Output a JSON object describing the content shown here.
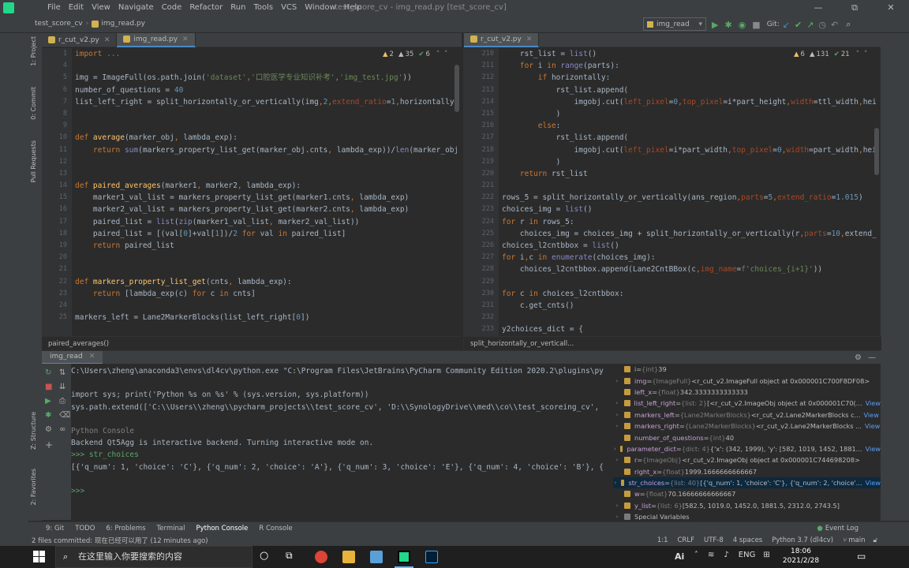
{
  "window": {
    "title": "test_score_cv - img_read.py [test_score_cv]",
    "menu": [
      "File",
      "Edit",
      "View",
      "Navigate",
      "Code",
      "Refactor",
      "Run",
      "Tools",
      "VCS",
      "Window",
      "Help"
    ],
    "controls": {
      "minimize": "—",
      "maximize": "⧉",
      "close": "✕"
    }
  },
  "navbar": {
    "project": "test_score_cv",
    "file": "img_read.py",
    "run_config": "img_read",
    "git_label": "Git:"
  },
  "left_tools": [
    "1: Project",
    "0: Commit",
    "Pull Requests",
    "Z: Structure",
    "2: Favorites"
  ],
  "left_editor": {
    "tabs": [
      {
        "label": "r_cut_v2.py",
        "active": false
      },
      {
        "label": "img_read.py",
        "active": true
      }
    ],
    "inspections": {
      "warnings": "2",
      "weak": "35",
      "ok": "6"
    },
    "breadcrumb": "paired_averages()",
    "line_numbers": [
      "1",
      "4",
      "5",
      "6",
      "7",
      "8",
      "9",
      "10",
      "11",
      "12",
      "13",
      "14",
      "15",
      "16",
      "17",
      "18",
      "19",
      "20",
      "21",
      "22",
      "23",
      "24",
      "25"
    ],
    "lines": [
      "import ...",
      "",
      "img = ImageFull(os.path.join('dataset','口腔医学专业知识补考','img_test.jpg'))",
      "number_of_questions = 40",
      "list_left_right = split_horizontally_or_vertically(img,2,extend_ratio=1,horizontally=",
      "",
      "",
      "def average(marker_obj, lambda_exp):",
      "    return sum(markers_property_list_get(marker_obj.cnts, lambda_exp))/len(marker_obj",
      "",
      "",
      "def paired_averages(marker1, marker2, lambda_exp):",
      "    marker1_val_list = markers_property_list_get(marker1.cnts, lambda_exp)",
      "    marker2_val_list = markers_property_list_get(marker2.cnts, lambda_exp)",
      "    paired_list = list(zip(marker1_val_list, marker2_val_list))",
      "    paired_list = [(val[0]+val[1])/2 for val in paired_list]",
      "    return paired_list",
      "",
      "",
      "def markers_property_list_get(cnts, lambda_exp):",
      "    return [lambda_exp(c) for c in cnts]",
      "",
      "markers_left = Lane2MarkerBlocks(list_left_right[0])"
    ]
  },
  "right_editor": {
    "tabs": [
      {
        "label": "r_cut_v2.py",
        "active": true
      }
    ],
    "inspections": {
      "warnings": "6",
      "weak": "131",
      "ok": "21"
    },
    "breadcrumb": "split_horizontally_or_verticall...",
    "line_numbers": [
      "210",
      "211",
      "212",
      "213",
      "214",
      "215",
      "216",
      "217",
      "218",
      "219",
      "220",
      "221",
      "222",
      "223",
      "224",
      "225",
      "226",
      "227",
      "228",
      "229",
      "230",
      "231",
      "232",
      "233"
    ],
    "lines": [
      "    rst_list = list()",
      "    for i in range(parts):",
      "        if horizontally:",
      "            rst_list.append(",
      "                imgobj.cut(left_pixel=0,top_pixel=i*part_height,width=ttl_width,hei",
      "            )",
      "        else:",
      "            rst_list.append(",
      "                imgobj.cut(left_pixel=i*part_width,top_pixel=0,width=part_width,hei",
      "            )",
      "    return rst_list",
      "",
      "rows_5 = split_horizontally_or_vertically(ans_region,parts=5,extend_ratio=1.015)",
      "choices_img = list()",
      "for r in rows_5:",
      "    choices_img = choices_img + split_horizontally_or_vertically(r,parts=10,extend_r",
      "choices_l2cntbbox = list()",
      "for i,c in enumerate(choices_img):",
      "    choices_l2cntbbox.append(Lane2CntBBox(c,img_name=f'choices_{i+1}'))",
      "",
      "for c in choices_l2cntbbox:",
      "    c.get_cnts()",
      "",
      "y2choices_dict = {"
    ]
  },
  "run_panel": {
    "tab": "img_read",
    "console_lines": [
      "C:\\Users\\zheng\\anaconda3\\envs\\dl4cv\\python.exe \"C:\\Program Files\\JetBrains\\PyCharm Community Edition 2020.2\\plugins\\py",
      "",
      "import sys; print('Python %s on %s' % (sys.version, sys.platform))",
      "sys.path.extend(['C:\\\\Users\\\\zheng\\\\pycharm_projects\\\\test_score_cv', 'D:\\\\SynologyDrive\\\\med\\\\co\\\\test_scoreing_cv',",
      "",
      "Python Console",
      "Backend Qt5Agg is interactive backend. Turning interactive mode on.",
      ">>> str_choices",
      "[{'q_num': 1, 'choice': 'C'}, {'q_num': 2, 'choice': 'A'}, {'q_num': 3, 'choice': 'E'}, {'q_num': 4, 'choice': 'B'}, {",
      "",
      ">>> "
    ],
    "variables": [
      {
        "name": "i",
        "type": "{int}",
        "value": "39",
        "expand": false,
        "link": ""
      },
      {
        "name": "img",
        "type": "{ImageFull}",
        "value": "<r_cut_v2.ImageFull object at 0x000001C700F8DF08>",
        "expand": true,
        "link": ""
      },
      {
        "name": "left_x",
        "type": "{float}",
        "value": "342.3333333333333",
        "expand": false,
        "link": ""
      },
      {
        "name": "list_left_right",
        "type": "{list: 2}",
        "value": "[<r_cut_v2.ImageObj object at 0x000001C70(...",
        "expand": true,
        "link": "View"
      },
      {
        "name": "markers_left",
        "type": "{Lane2MarkerBlocks}",
        "value": "<r_cut_v2.Lane2MarkerBlocks c...",
        "expand": true,
        "link": "View"
      },
      {
        "name": "markers_right",
        "type": "{Lane2MarkerBlocks}",
        "value": "<r_cut_v2.Lane2MarkerBlocks ...",
        "expand": true,
        "link": "View"
      },
      {
        "name": "number_of_questions",
        "type": "{int}",
        "value": "40",
        "expand": false,
        "link": ""
      },
      {
        "name": "parameter_dict",
        "type": "{dict: 4}",
        "value": "{'x': (342, 1999), 'y': [582, 1019, 1452, 1881...",
        "expand": true,
        "link": "View"
      },
      {
        "name": "r",
        "type": "{ImageObj}",
        "value": "<r_cut_v2.ImageObj object at 0x000001C744698208>",
        "expand": true,
        "link": ""
      },
      {
        "name": "right_x",
        "type": "{float}",
        "value": "1999.1666666666667",
        "expand": false,
        "link": ""
      },
      {
        "name": "str_choices",
        "type": "{list: 40}",
        "value": "[{'q_num': 1, 'choice': 'C'}, {'q_num': 2, 'choice'...",
        "expand": true,
        "link": "View",
        "selected": true
      },
      {
        "name": "w",
        "type": "{float}",
        "value": "70.16666666666667",
        "expand": false,
        "link": ""
      },
      {
        "name": "y_list",
        "type": "{list: 6}",
        "value": "[582.5, 1019.0, 1452.0, 1881.5, 2312.0, 2743.5]",
        "expand": true,
        "link": ""
      },
      {
        "name": "Special Variables",
        "type": "",
        "value": "",
        "expand": true,
        "link": ""
      }
    ]
  },
  "tool_tabs": [
    "9: Git",
    "TODO",
    "6: Problems",
    "Terminal",
    "Python Console",
    "R Console"
  ],
  "event_log": "Event Log",
  "status": {
    "message": "2 files committed: 现在已经可以用了 (12 minutes ago)",
    "position": "1:1",
    "line_sep": "CRLF",
    "encoding": "UTF-8",
    "indent": "4 spaces",
    "interpreter": "Python 3.7 (dl4cv)",
    "branch": "main"
  },
  "taskbar": {
    "search_placeholder": "在这里输入你要搜索的内容",
    "ime": "ENG",
    "time": "18:06",
    "date": "2021/2/28",
    "ai_label": "Ai"
  }
}
